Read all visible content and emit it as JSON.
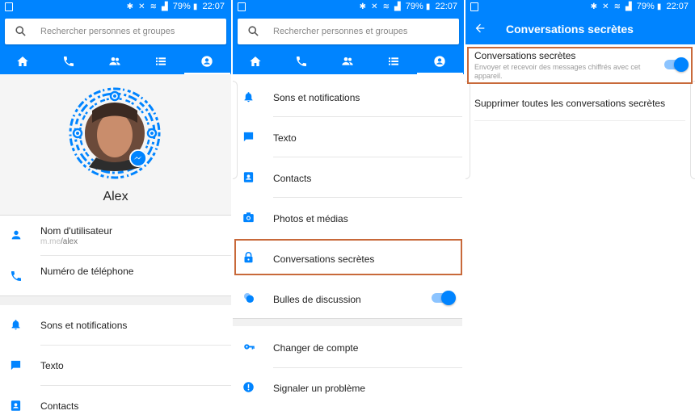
{
  "status_bar": {
    "battery": "79%",
    "time": "22:07"
  },
  "search": {
    "placeholder": "Rechercher personnes et groupes"
  },
  "tab_icons": [
    "home-icon",
    "phone-icon",
    "people-icon",
    "list-icon",
    "profile-icon"
  ],
  "screen1": {
    "profile_name": "Alex",
    "account_rows": [
      {
        "label": "Nom d'utilisateur",
        "sub_prefix": "m.me",
        "sub_suffix": "/alex",
        "icon": "person-icon"
      },
      {
        "label": "Numéro de téléphone",
        "icon": "phone-icon"
      }
    ],
    "settings_rows": [
      {
        "label": "Sons et notifications",
        "icon": "bell-icon"
      },
      {
        "label": "Texto",
        "icon": "message-icon"
      },
      {
        "label": "Contacts",
        "icon": "contacts-icon"
      }
    ]
  },
  "screen2": {
    "settings_rows": [
      {
        "label": "Sons et notifications",
        "icon": "bell-icon"
      },
      {
        "label": "Texto",
        "icon": "message-icon"
      },
      {
        "label": "Contacts",
        "icon": "contacts-icon"
      },
      {
        "label": "Photos et médias",
        "icon": "camera-icon"
      },
      {
        "label": "Conversations secrètes",
        "icon": "lock-icon",
        "highlighted": true
      },
      {
        "label": "Bulles de discussion",
        "icon": "bubbles-icon",
        "toggle": true
      }
    ],
    "other_rows": [
      {
        "label": "Changer de compte",
        "icon": "key-icon"
      },
      {
        "label": "Signaler un problème",
        "icon": "alert-icon"
      }
    ]
  },
  "screen3": {
    "title": "Conversations secrètes",
    "option_title": "Conversations secrètes",
    "option_desc": "Envoyer et recevoir des messages chiffrés avec cet appareil.",
    "delete_label": "Supprimer toutes les conversations secrètes"
  },
  "colors": {
    "accent": "#0084ff",
    "highlight": "#c8693a"
  }
}
